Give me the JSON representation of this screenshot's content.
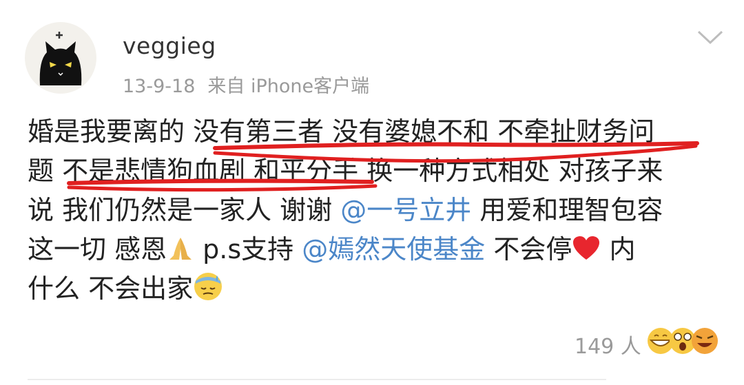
{
  "post": {
    "username": "veggieg",
    "date": "13-9-18",
    "source": "来自 iPhone客户端",
    "body": {
      "line1": "婚是我要离的 没有第三者 没有婆媳不和 不牵扯财务问",
      "line2": "题 不是悲情狗血剧 和平分手 换一种方式相处 对孩子来",
      "line3_a": "说 我们仍然是一家人 谢谢 ",
      "line3_mention": "@一号立井",
      "line3_b": " 用爱和理智包容",
      "line4_a": "这一切 感恩",
      "line4_b": " p.s支持 ",
      "line4_mention": "@嫣然天使基金",
      "line4_c": " 不会停",
      "line4_d": " 内",
      "line5_a": "什么 不会出家"
    },
    "likes_count": "149 人"
  },
  "icons": {
    "more": "chevron-down-icon",
    "pray": "pray-emoji-icon",
    "heart": "heart-emoji-icon",
    "sweat": "sweat-face-emoji-icon",
    "reactions": "reaction-emoji-icons"
  },
  "colors": {
    "mention": "#4b86c8",
    "underline": "#e02020",
    "meta": "#9a9a9a"
  }
}
